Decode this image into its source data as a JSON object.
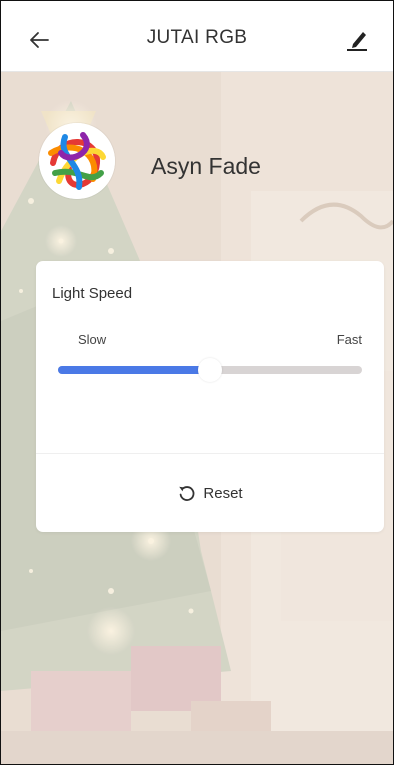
{
  "header": {
    "title": "JUTAI RGB"
  },
  "mode": {
    "name": "Asyn Fade"
  },
  "speed_card": {
    "title": "Light Speed",
    "min_label": "Slow",
    "max_label": "Fast",
    "value_fraction": 0.5,
    "reset_label": "Reset"
  },
  "colors": {
    "accent": "#4a79e6",
    "track": "#d8d4d4",
    "text": "#333333"
  }
}
